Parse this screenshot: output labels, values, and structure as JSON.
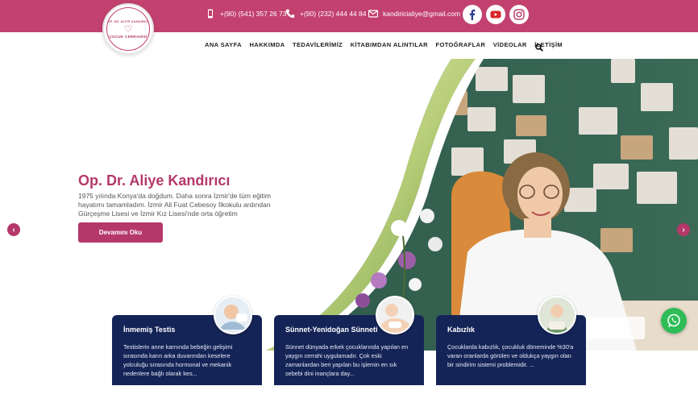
{
  "topbar": {
    "phone1": "+(90) (541) 357 26 73",
    "phone2": "+(90) (232) 444 44 84",
    "email": "kandiricialiye@gmail.com",
    "social": [
      "facebook-icon",
      "youtube-icon",
      "instagram-icon"
    ]
  },
  "logo": {
    "top_text": "OP. DR. ALİYE KANDIRICI",
    "bottom_text": "ÇOCUK CERRAHİSİ"
  },
  "nav": {
    "items": [
      "ANA SAYFA",
      "HAKKIMDA",
      "TEDAVİLERİMİZ",
      "KİTABIMDAN ALINTILAR",
      "FOTOĞRAFLAR",
      "VİDEOLAR",
      "İLETİŞİM"
    ]
  },
  "hero": {
    "title": "Op. Dr. Aliye Kandırıcı",
    "description": "1975 yılında Konya'da doğdum. Daha sonra İzmir'de tüm eğitim hayatımı tamamladım. İzmir Ali Fuat Cebesoy İlkokulu ardından Gürçeşme Lisesi ve İzmir Kız Lisesi'nde orta öğretim",
    "button": "Devamını Oku"
  },
  "cards": [
    {
      "title": "İnmemiş Testis",
      "text": "Testislerin anne karnında bebeğin gelişimi sırasında karın arka duvarından keselere yolculuğu sırasında hormonal ve mekanik nedenlere bağlı olarak kes..."
    },
    {
      "title": "Sünnet-Yenidoğan Sünneti",
      "text": "Sünnet dünyada erkek çocuklarında yapılan en yaygın cerrahi uygulamadır. Çok eski zamanlardan beri yapılan bu işlemin en sık sebebi dini inançlara day..."
    },
    {
      "title": "Kabızlık",
      "text": "Çocuklarda kabızlık, çocukluk döneminde %30'a varan oranlarda görülen ve oldukça yaygın olan bir sindirim sistemi problemidir. ..."
    }
  ],
  "colors": {
    "brand": "#c2416f",
    "accent": "#b5386a",
    "card_bg": "#152457",
    "whatsapp": "#2fbc57"
  }
}
